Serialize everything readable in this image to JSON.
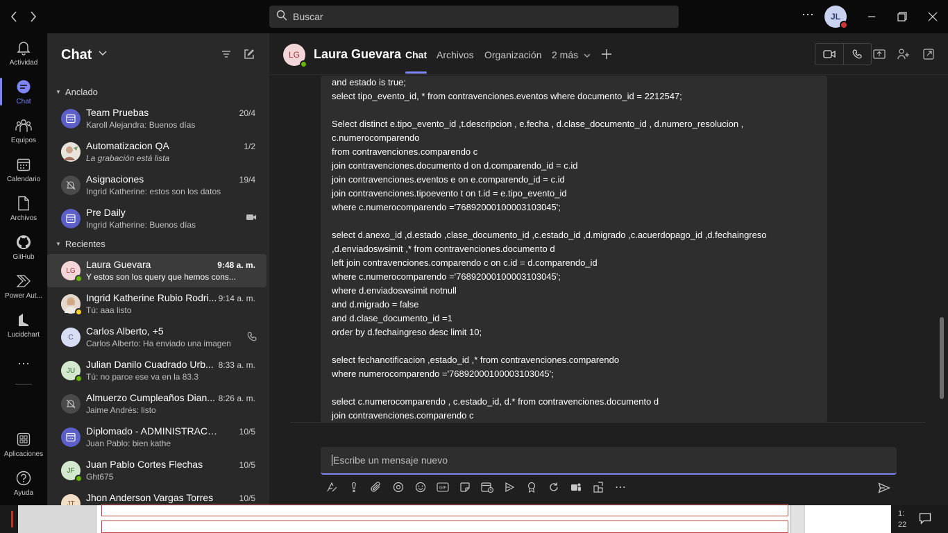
{
  "titlebar": {
    "search_placeholder": "Buscar",
    "more": "⋯",
    "user_initials": "JL"
  },
  "rail": [
    {
      "label": "Actividad",
      "icon": "bell-icon"
    },
    {
      "label": "Chat",
      "icon": "chat-icon",
      "active": true
    },
    {
      "label": "Equipos",
      "icon": "teams-icon"
    },
    {
      "label": "Calendario",
      "icon": "calendar-icon"
    },
    {
      "label": "Archivos",
      "icon": "file-icon"
    },
    {
      "label": "GitHub",
      "icon": "github-icon"
    },
    {
      "label": "Power Aut...",
      "icon": "power-automate-icon"
    },
    {
      "label": "Lucidchart",
      "icon": "lucidchart-icon"
    },
    {
      "label": "Aplicaciones",
      "icon": "apps-icon"
    },
    {
      "label": "Ayuda",
      "icon": "help-icon"
    }
  ],
  "chatlist": {
    "title": "Chat",
    "pinned_label": "Anclado",
    "recent_label": "Recientes",
    "pinned": [
      {
        "name": "Team Pruebas",
        "message": "Karoll Alejandra: Buenos días",
        "time": "20/4",
        "avatar": "group"
      },
      {
        "name": "Automatizacion QA",
        "message": "La grabación está lista",
        "time": "1/2",
        "avatar": "photo"
      },
      {
        "name": "Asignaciones",
        "message": "Ingrid Katherine: estos son los datos",
        "time": "19/4",
        "avatar": "muted"
      },
      {
        "name": "Pre Daily",
        "message": "Ingrid Katherine: Buenos días",
        "time": "",
        "avatar": "group"
      }
    ],
    "recent": [
      {
        "name": "Laura Guevara",
        "message": "Y estos son los query que hemos cons...",
        "time": "9:48 a. m.",
        "initials": "LG"
      },
      {
        "name": "Ingrid Katherine Rubio Rodri...",
        "message": "Tú: aaa listo",
        "time": "9:14 a. m.",
        "initials": ""
      },
      {
        "name": "Carlos Alberto, +5",
        "message": "Carlos Alberto: Ha enviado una imagen",
        "time": "",
        "initials": "C"
      },
      {
        "name": "Julian Danilo Cuadrado Urb...",
        "message": "Tú: no parce ese va en la 83.3",
        "time": "8:33 a. m.",
        "initials": "JU"
      },
      {
        "name": "Almuerzo Cumpleaños Dian...",
        "message": "Jaime Andrés: listo",
        "time": "8:26 a. m.",
        "initials": ""
      },
      {
        "name": "Diplomado - ADMINISTRACIÓN ...",
        "message": "Juan Pablo: bien kathe",
        "time": "10/5",
        "initials": ""
      },
      {
        "name": "Juan Pablo Cortes Flechas",
        "message": "Ght675",
        "time": "10/5",
        "initials": "JF"
      },
      {
        "name": "Jhon Anderson Vargas Torres",
        "message": "",
        "time": "10/5",
        "initials": "JT"
      }
    ]
  },
  "conversation": {
    "initials": "LG",
    "name": "Laura Guevara",
    "tabs": [
      "Chat",
      "Archivos",
      "Organización",
      "2 más"
    ],
    "lines": [
      "and estado is true;",
      "select tipo_evento_id, * from contravenciones.eventos where documento_id = 2212547;",
      "",
      "Select distinct e.tipo_evento_id ,t.descripcion , e.fecha , d.clase_documento_id , d.numero_resolucion ,",
      "c.numerocomparendo",
      "from contravenciones.comparendo c",
      "join contravenciones.documento d on d.comparendo_id = c.id",
      "join contravenciones.eventos e on e.comparendo_id = c.id",
      "join contravenciones.tipoevento t on t.id = e.tipo_evento_id",
      "where c.numerocomparendo ='76892000100003103045';",
      "",
      "select d.anexo_id ,d.estado ,clase_documento_id ,c.estado_id ,d.migrado ,c.acuerdopago_id ,d.fechaingreso",
      ",d.enviadoswsimit ,* from contravenciones.documento d",
      "left join contravenciones.comparendo c on c.id = d.comparendo_id",
      "where c.numerocomparendo ='76892000100003103045';",
      "where d.enviadoswsimit notnull",
      "and d.migrado = false",
      "and d.clase_documento_id =1",
      "order by d.fechaingreso desc limit 10;",
      "",
      "select fechanotificacion ,estado_id ,* from contravenciones.comparendo",
      "where numerocomparendo ='76892000100003103045';",
      "",
      "select c.numerocomparendo , c.estado_id, d.* from contravenciones.documento d",
      "join contravenciones.comparendo c"
    ],
    "composer_placeholder": "Escribe un mensaje nuevo"
  },
  "taskbar": {
    "clock_fragment_1": "1:",
    "clock_fragment_2": "22"
  },
  "colors": {
    "accent": "#7f85f5",
    "available": "#6bb700",
    "away": "#f8d22a",
    "busy": "#d13438"
  }
}
